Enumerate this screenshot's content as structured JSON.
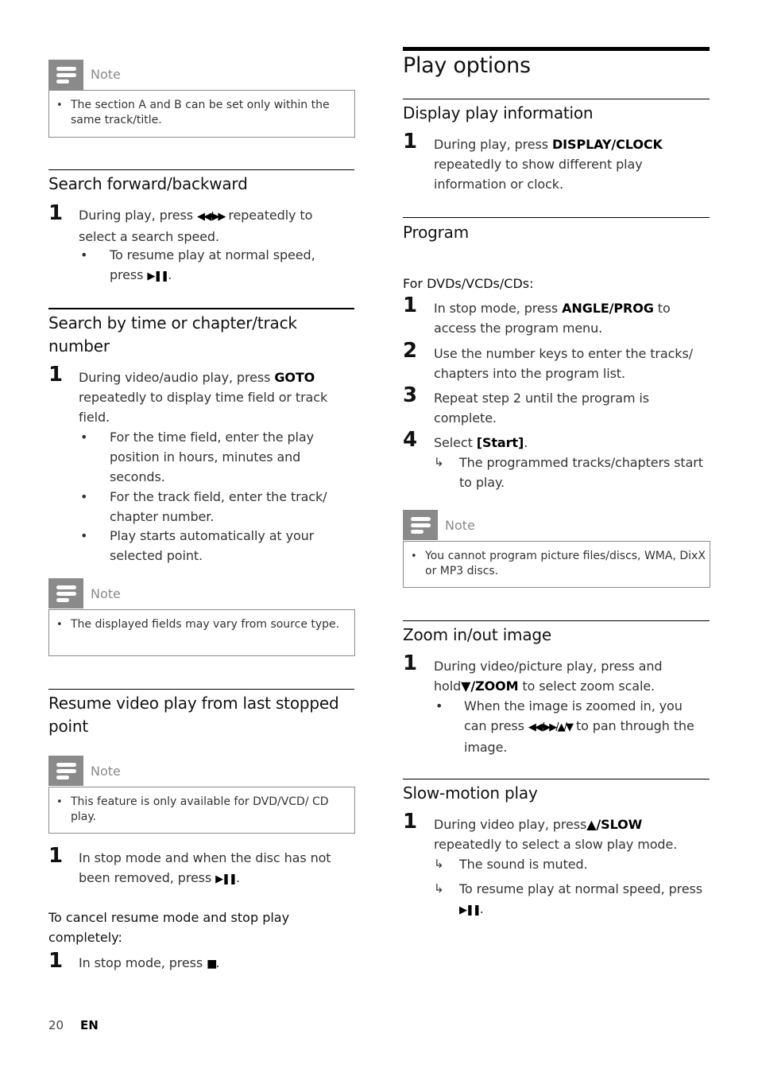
{
  "left": {
    "note1": {
      "title": "Note",
      "text": "The section A and B can be set only within the same track/title."
    },
    "search_fb": {
      "heading": "Search forward/backward",
      "step1_num": "1",
      "step1_a": "During play, press ",
      "step1_sym": "◀◀/▶▶",
      "step1_b": " repeatedly to select a search speed.",
      "bullet1_a": "To resume play at normal speed, press ",
      "bullet1_sym": "▶❚❚",
      "bullet1_b": "."
    },
    "search_time": {
      "heading": "Search by time or chapter/track number",
      "step1_num": "1",
      "step1_a": "During video/audio play, press ",
      "step1_key": "GOTO",
      "step1_b": " repeatedly to display time field or track field.",
      "bullets": [
        "For the time field, enter the play position in hours, minutes and seconds.",
        "For the track field, enter the track/ chapter number.",
        "Play starts automatically at your selected point."
      ]
    },
    "note2": {
      "title": "Note",
      "text": "The displayed fields may vary from source type."
    },
    "resume": {
      "heading": "Resume video play from last stopped point",
      "note": {
        "title": "Note",
        "text": "This feature is only available for DVD/VCD/ CD play."
      },
      "step1_num": "1",
      "step1_a": "In stop mode and when the disc has not been removed, press ",
      "step1_sym": "▶❚❚",
      "step1_b": ".",
      "cancel_heading": "To cancel resume mode and stop play completely:",
      "cancel_step_num": "1",
      "cancel_step_a": "In stop mode, press ",
      "cancel_step_sym": "■",
      "cancel_step_b": "."
    }
  },
  "right": {
    "title": "Play options",
    "display": {
      "heading": "Display play information",
      "step1_num": "1",
      "step1_a": "During play, press ",
      "step1_key": "DISPLAY/CLOCK",
      "step1_b": " repeatedly to show different play information or clock."
    },
    "program": {
      "heading": "Program",
      "sub": "For DVDs/VCDs/CDs:",
      "steps": [
        {
          "num": "1",
          "a": "In stop mode, press ",
          "key": "ANGLE/PROG",
          "b": " to access the program menu."
        },
        {
          "num": "2",
          "a": "Use the number keys to enter the tracks/ chapters into the program list.",
          "key": "",
          "b": ""
        },
        {
          "num": "3",
          "a": "Repeat step 2 until the program is complete.",
          "key": "",
          "b": ""
        },
        {
          "num": "4",
          "a": "Select ",
          "key": "[Start]",
          "b": "."
        }
      ],
      "result": "The programmed tracks/chapters start to play.",
      "note": {
        "title": "Note",
        "text": "You cannot program picture files/discs, WMA, DixX or MP3 discs."
      }
    },
    "zoom": {
      "heading": "Zoom in/out image",
      "step1_num": "1",
      "step1_a": "During video/picture play, press and hold",
      "step1_key": "▼/ZOOM",
      "step1_b": " to select zoom scale.",
      "bullet_a": "When the image is zoomed in, you can press ",
      "bullet_sym": "◀◀/▶▶/▲/▼",
      "bullet_b": " to pan through the image."
    },
    "slow": {
      "heading": "Slow-motion play",
      "step1_num": "1",
      "step1_a": "During video play, press",
      "step1_key": "▲/SLOW",
      "step1_b": " repeatedly to select a slow play mode.",
      "result1": "The sound is muted.",
      "result2_a": "To resume play at normal speed, press ",
      "result2_sym": "▶❚❚",
      "result2_b": "."
    }
  },
  "footer": {
    "page": "20",
    "lang": "EN"
  }
}
